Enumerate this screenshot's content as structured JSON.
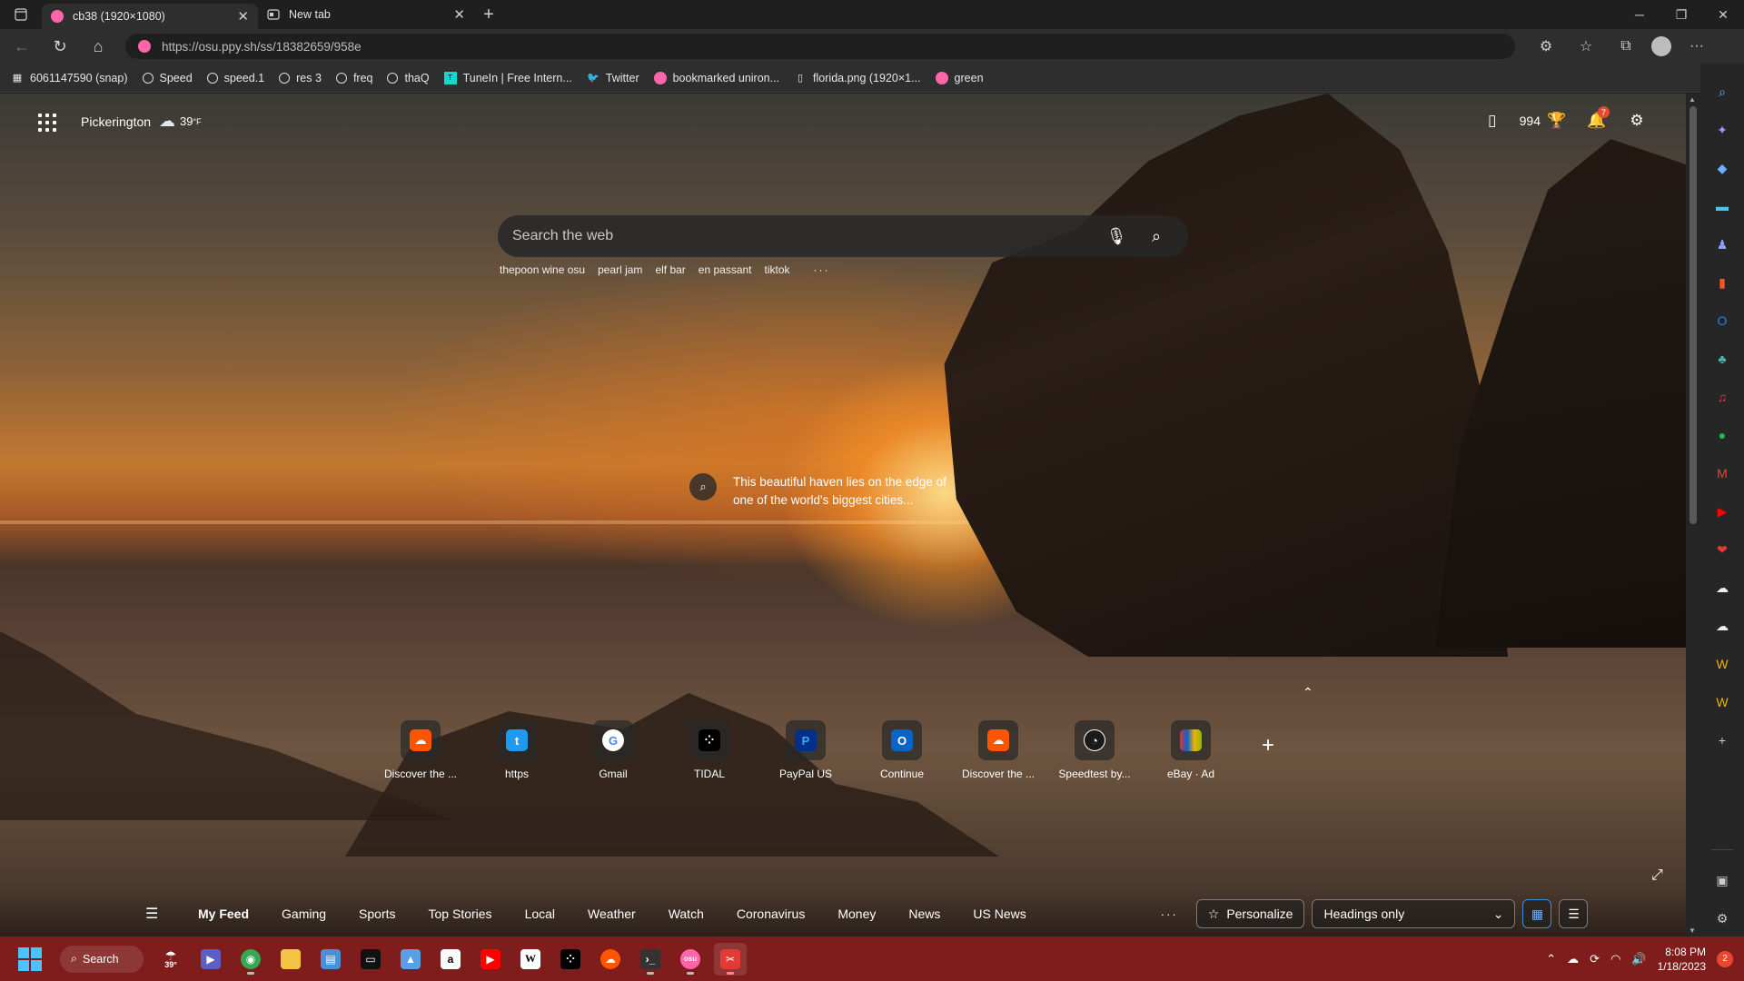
{
  "tabs": [
    {
      "title": "cb38 (1920×1080)",
      "favicon_color": "#ff66aa",
      "active": true
    },
    {
      "title": "New tab",
      "active": false
    }
  ],
  "address": {
    "url": "https://osu.ppy.sh/ss/18382659/958e"
  },
  "bookmarks": [
    {
      "label": "6061147590 (snap)",
      "icon": "calendar-icon"
    },
    {
      "label": "Speed",
      "icon": "speedometer-icon"
    },
    {
      "label": "speed.1",
      "icon": "speedometer-icon"
    },
    {
      "label": "res 3",
      "icon": "speedometer-icon"
    },
    {
      "label": "freq",
      "icon": "speedometer-icon"
    },
    {
      "label": "thaQ",
      "icon": "speedometer-icon"
    },
    {
      "label": "TuneIn | Free Intern...",
      "icon": "tunein-icon"
    },
    {
      "label": "Twitter",
      "icon": "twitter-icon"
    },
    {
      "label": "bookmarked uniron...",
      "icon": "osu-icon"
    },
    {
      "label": "florida.png (1920×1...",
      "icon": "file-icon"
    },
    {
      "label": "green",
      "icon": "osu-icon"
    }
  ],
  "header": {
    "location": "Pickerington",
    "temperature": "39",
    "temp_unit": "°F",
    "rewards_points": "994",
    "notifications_count": "7"
  },
  "search": {
    "placeholder": "Search the web"
  },
  "trending": [
    "thepoon wine osu",
    "pearl jam",
    "elf bar",
    "en passant",
    "tiktok"
  ],
  "trending_more": "···",
  "caption": {
    "text": "This beautiful haven lies on the edge of one of the world's biggest cities..."
  },
  "quick_links": [
    {
      "label": "Discover the ...",
      "color": "#ff5500",
      "glyph": "☁"
    },
    {
      "label": "https",
      "color": "#1d9bf0",
      "glyph": "🐦"
    },
    {
      "label": "Gmail",
      "color": "#ffffff",
      "glyph": "G"
    },
    {
      "label": "TIDAL",
      "color": "#000000",
      "glyph": "⁘"
    },
    {
      "label": "PayPal US",
      "color": "#003087",
      "glyph": "P"
    },
    {
      "label": "Continue",
      "color": "#0a64c8",
      "glyph": "O"
    },
    {
      "label": "Discover the ...",
      "color": "#ff5500",
      "glyph": "☁"
    },
    {
      "label": "Speedtest by...",
      "color": "#1a1a1a",
      "glyph": "◔"
    },
    {
      "label": "eBay · Ad",
      "color": "#2a2a2a",
      "glyph": "🛍"
    }
  ],
  "feed": {
    "tabs": [
      "My Feed",
      "Gaming",
      "Sports",
      "Top Stories",
      "Local",
      "Weather",
      "Watch",
      "Coronavirus",
      "Money",
      "News",
      "US News"
    ],
    "more": "···",
    "personalize": "Personalize",
    "layout_option": "Headings only"
  },
  "taskbar": {
    "search": "Search",
    "weather_temp": "39°",
    "time": "8:08 PM",
    "date": "1/18/2023",
    "notification_count": "2"
  }
}
